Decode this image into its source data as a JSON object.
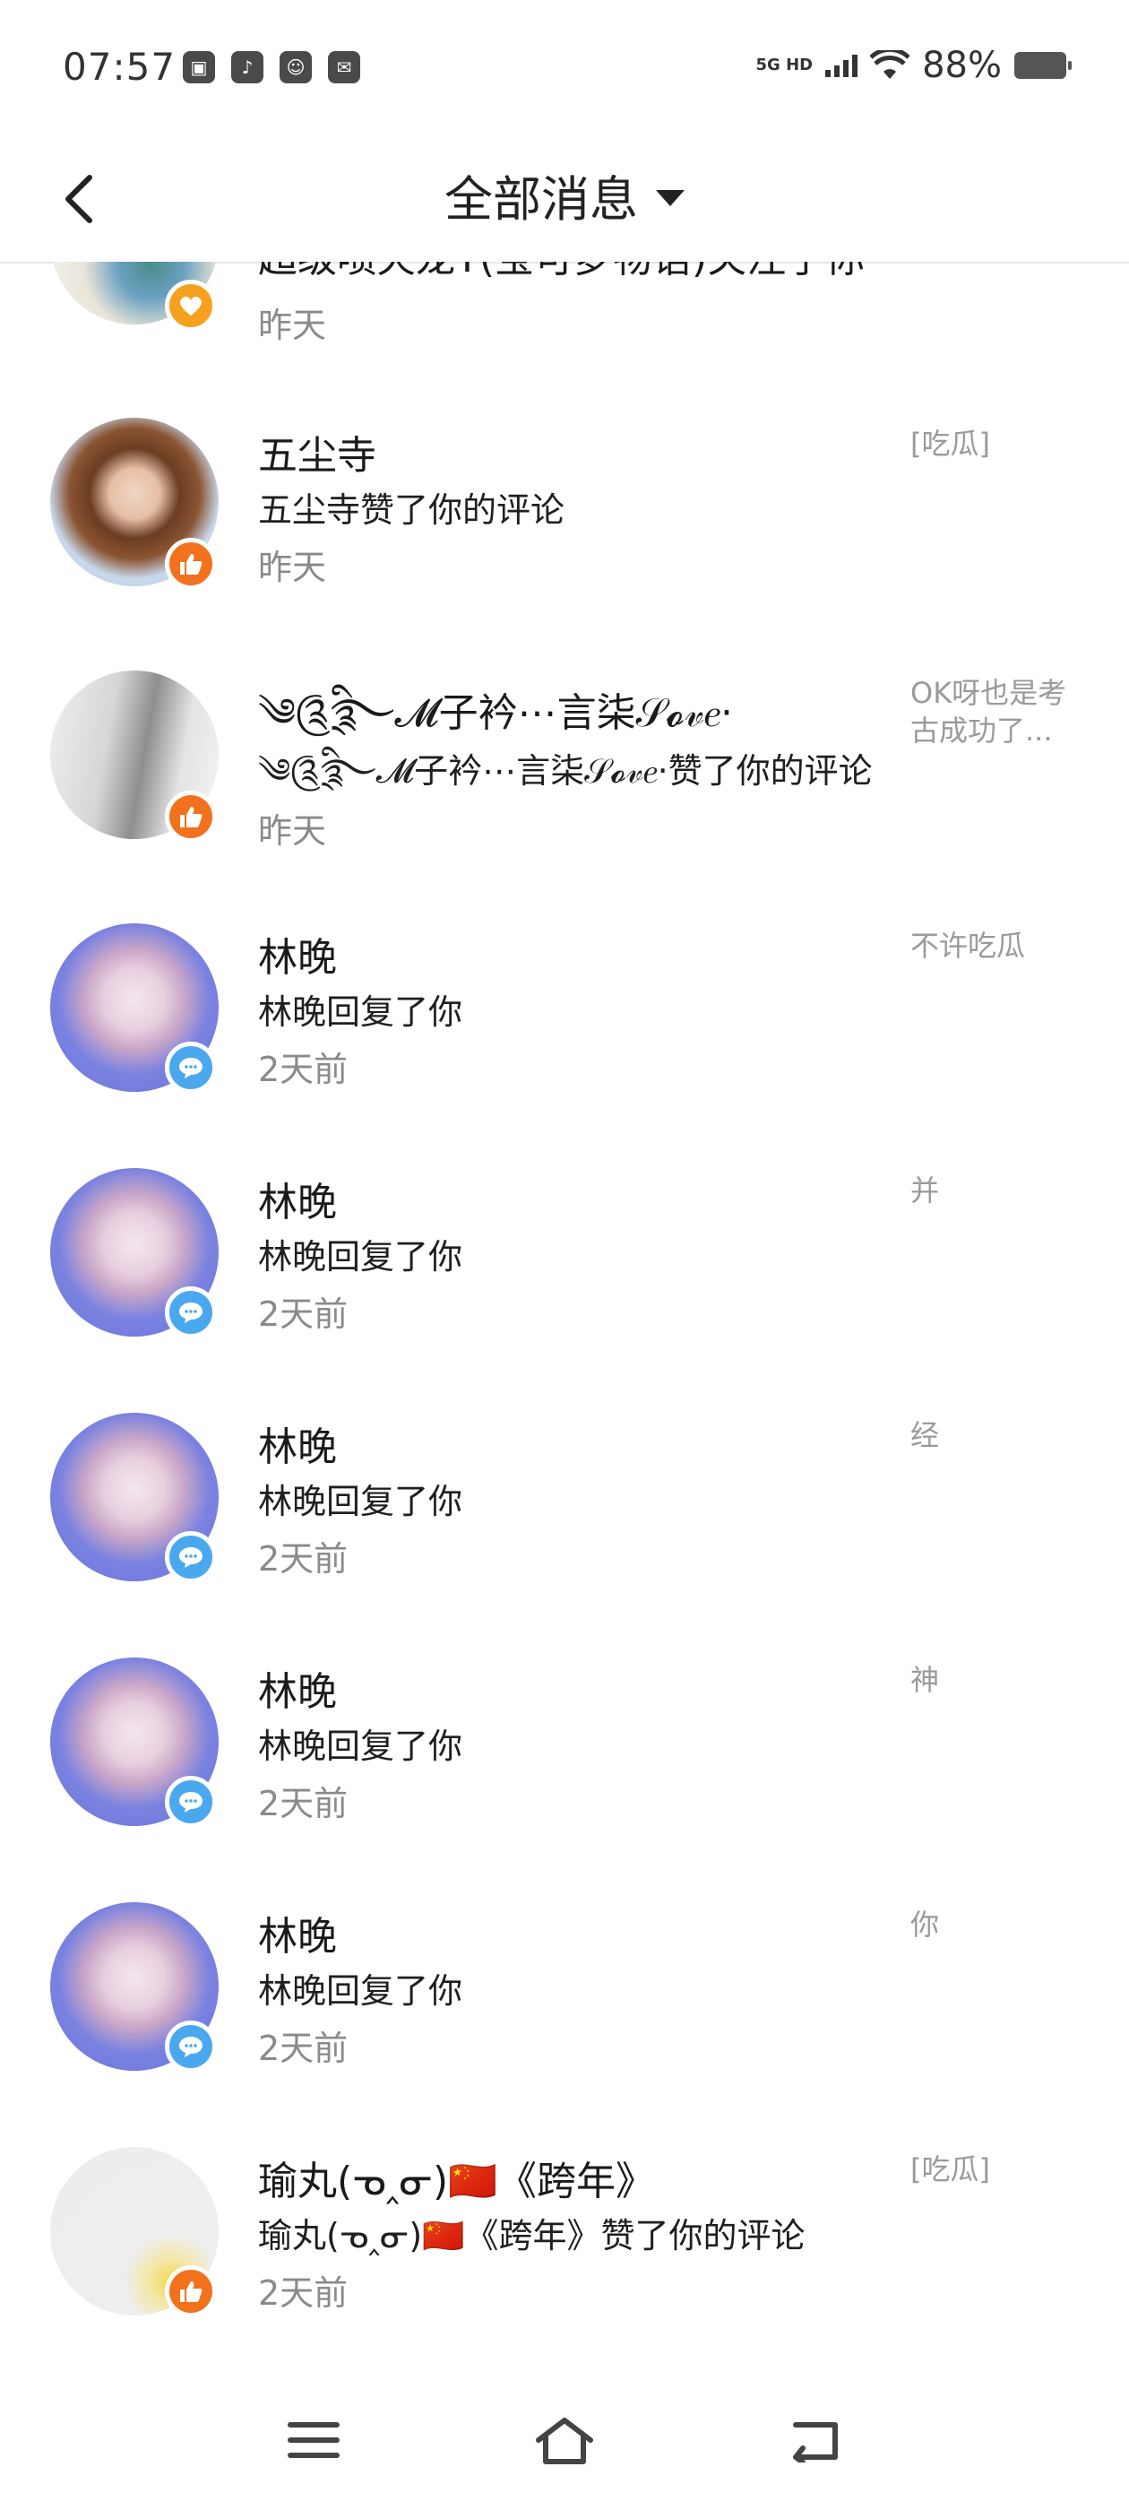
{
  "status_bar": {
    "time": "07:57",
    "network": "5G HD",
    "battery": "88%"
  },
  "header": {
    "title": "全部消息"
  },
  "notifications": [
    {
      "name": "超级喷火龙Y(宝可梦物语)关注了你",
      "action": "",
      "time": "昨天",
      "preview": "",
      "badge": "heart"
    },
    {
      "name": "五尘寺",
      "action": "五尘寺赞了你的评论",
      "time": "昨天",
      "preview": "[吃瓜]",
      "badge": "like"
    },
    {
      "name": "༄༊྄ི࿐𝓜子衿⋯言柒𝒮𝓸𝓋𝑒·",
      "action": "༄༊྄ི࿐𝓜子衿⋯言柒𝒮𝓸𝓋𝑒·赞了你的评论",
      "time": "昨天",
      "preview": "OK呀也是考古成功了...",
      "badge": "like"
    },
    {
      "name": "林晚",
      "action": "林晚回复了你",
      "time": "2天前",
      "preview": "不许吃瓜",
      "badge": "comment"
    },
    {
      "name": "林晚",
      "action": "林晚回复了你",
      "time": "2天前",
      "preview": "并",
      "badge": "comment"
    },
    {
      "name": "林晚",
      "action": "林晚回复了你",
      "time": "2天前",
      "preview": "经",
      "badge": "comment"
    },
    {
      "name": "林晚",
      "action": "林晚回复了你",
      "time": "2天前",
      "preview": "神",
      "badge": "comment"
    },
    {
      "name": "林晚",
      "action": "林晚回复了你",
      "time": "2天前",
      "preview": "你",
      "badge": "comment"
    },
    {
      "name": "瑜丸(ᓀ‸ᓂ)🇨🇳《跨年》",
      "action": "瑜丸(ᓀ‸ᓂ)🇨🇳《跨年》赞了你的评论",
      "time": "2天前",
      "preview": "[吃瓜]",
      "badge": "like"
    }
  ],
  "icons": {
    "back": "chevron-left-icon",
    "dropdown": "caret-down-icon",
    "like": "thumbs-up-icon",
    "comment": "comment-bubble-icon",
    "heart": "heart-icon",
    "menu": "menu-icon",
    "home": "home-icon",
    "recent": "back-arrow-icon"
  },
  "colors": {
    "like_badge": "#f2711c",
    "heart_badge": "#f7a020",
    "comment_badge": "#4aa8ef",
    "secondary_text": "#8a8a8a"
  }
}
